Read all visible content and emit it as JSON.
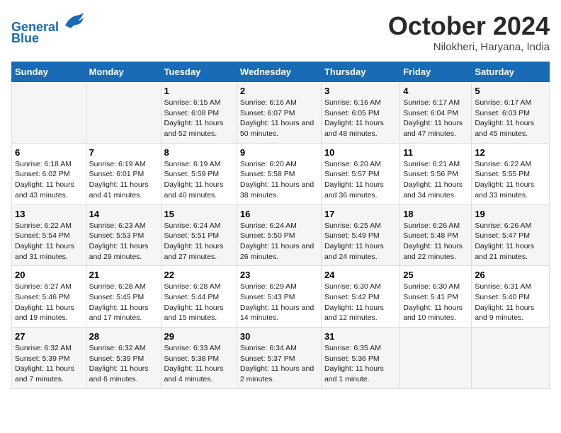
{
  "logo": {
    "line1": "General",
    "line2": "Blue"
  },
  "title": "October 2024",
  "location": "Nilokheri, Haryana, India",
  "days_of_week": [
    "Sunday",
    "Monday",
    "Tuesday",
    "Wednesday",
    "Thursday",
    "Friday",
    "Saturday"
  ],
  "weeks": [
    [
      {
        "day": "",
        "info": ""
      },
      {
        "day": "",
        "info": ""
      },
      {
        "day": "1",
        "info": "Sunrise: 6:15 AM\nSunset: 6:08 PM\nDaylight: 11 hours and 52 minutes."
      },
      {
        "day": "2",
        "info": "Sunrise: 6:16 AM\nSunset: 6:07 PM\nDaylight: 11 hours and 50 minutes."
      },
      {
        "day": "3",
        "info": "Sunrise: 6:16 AM\nSunset: 6:05 PM\nDaylight: 11 hours and 48 minutes."
      },
      {
        "day": "4",
        "info": "Sunrise: 6:17 AM\nSunset: 6:04 PM\nDaylight: 11 hours and 47 minutes."
      },
      {
        "day": "5",
        "info": "Sunrise: 6:17 AM\nSunset: 6:03 PM\nDaylight: 11 hours and 45 minutes."
      }
    ],
    [
      {
        "day": "6",
        "info": "Sunrise: 6:18 AM\nSunset: 6:02 PM\nDaylight: 11 hours and 43 minutes."
      },
      {
        "day": "7",
        "info": "Sunrise: 6:19 AM\nSunset: 6:01 PM\nDaylight: 11 hours and 41 minutes."
      },
      {
        "day": "8",
        "info": "Sunrise: 6:19 AM\nSunset: 5:59 PM\nDaylight: 11 hours and 40 minutes."
      },
      {
        "day": "9",
        "info": "Sunrise: 6:20 AM\nSunset: 5:58 PM\nDaylight: 11 hours and 38 minutes."
      },
      {
        "day": "10",
        "info": "Sunrise: 6:20 AM\nSunset: 5:57 PM\nDaylight: 11 hours and 36 minutes."
      },
      {
        "day": "11",
        "info": "Sunrise: 6:21 AM\nSunset: 5:56 PM\nDaylight: 11 hours and 34 minutes."
      },
      {
        "day": "12",
        "info": "Sunrise: 6:22 AM\nSunset: 5:55 PM\nDaylight: 11 hours and 33 minutes."
      }
    ],
    [
      {
        "day": "13",
        "info": "Sunrise: 6:22 AM\nSunset: 5:54 PM\nDaylight: 11 hours and 31 minutes."
      },
      {
        "day": "14",
        "info": "Sunrise: 6:23 AM\nSunset: 5:53 PM\nDaylight: 11 hours and 29 minutes."
      },
      {
        "day": "15",
        "info": "Sunrise: 6:24 AM\nSunset: 5:51 PM\nDaylight: 11 hours and 27 minutes."
      },
      {
        "day": "16",
        "info": "Sunrise: 6:24 AM\nSunset: 5:50 PM\nDaylight: 11 hours and 26 minutes."
      },
      {
        "day": "17",
        "info": "Sunrise: 6:25 AM\nSunset: 5:49 PM\nDaylight: 11 hours and 24 minutes."
      },
      {
        "day": "18",
        "info": "Sunrise: 6:26 AM\nSunset: 5:48 PM\nDaylight: 11 hours and 22 minutes."
      },
      {
        "day": "19",
        "info": "Sunrise: 6:26 AM\nSunset: 5:47 PM\nDaylight: 11 hours and 21 minutes."
      }
    ],
    [
      {
        "day": "20",
        "info": "Sunrise: 6:27 AM\nSunset: 5:46 PM\nDaylight: 11 hours and 19 minutes."
      },
      {
        "day": "21",
        "info": "Sunrise: 6:28 AM\nSunset: 5:45 PM\nDaylight: 11 hours and 17 minutes."
      },
      {
        "day": "22",
        "info": "Sunrise: 6:28 AM\nSunset: 5:44 PM\nDaylight: 11 hours and 15 minutes."
      },
      {
        "day": "23",
        "info": "Sunrise: 6:29 AM\nSunset: 5:43 PM\nDaylight: 11 hours and 14 minutes."
      },
      {
        "day": "24",
        "info": "Sunrise: 6:30 AM\nSunset: 5:42 PM\nDaylight: 11 hours and 12 minutes."
      },
      {
        "day": "25",
        "info": "Sunrise: 6:30 AM\nSunset: 5:41 PM\nDaylight: 11 hours and 10 minutes."
      },
      {
        "day": "26",
        "info": "Sunrise: 6:31 AM\nSunset: 5:40 PM\nDaylight: 11 hours and 9 minutes."
      }
    ],
    [
      {
        "day": "27",
        "info": "Sunrise: 6:32 AM\nSunset: 5:39 PM\nDaylight: 11 hours and 7 minutes."
      },
      {
        "day": "28",
        "info": "Sunrise: 6:32 AM\nSunset: 5:39 PM\nDaylight: 11 hours and 6 minutes."
      },
      {
        "day": "29",
        "info": "Sunrise: 6:33 AM\nSunset: 5:38 PM\nDaylight: 11 hours and 4 minutes."
      },
      {
        "day": "30",
        "info": "Sunrise: 6:34 AM\nSunset: 5:37 PM\nDaylight: 11 hours and 2 minutes."
      },
      {
        "day": "31",
        "info": "Sunrise: 6:35 AM\nSunset: 5:36 PM\nDaylight: 11 hours and 1 minute."
      },
      {
        "day": "",
        "info": ""
      },
      {
        "day": "",
        "info": ""
      }
    ]
  ]
}
